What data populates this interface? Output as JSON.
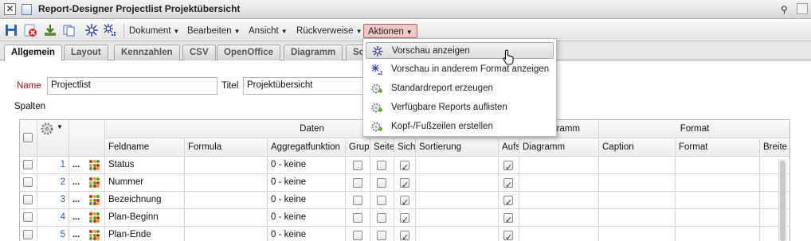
{
  "window": {
    "title": "Report-Designer Projectlist Projektübersicht",
    "close_glyph": "✕",
    "pin_glyph": "⚲"
  },
  "toolbar": {
    "icons": [
      "save-icon",
      "delete-icon",
      "download-icon",
      "copy-icon",
      "preview-icon",
      "preview-format-icon"
    ],
    "menus": [
      "Dokument",
      "Bearbeiten",
      "Ansicht",
      "Rückverweise",
      "Aktionen"
    ],
    "active_menu": "Aktionen",
    "active_color": "#f2c7c7"
  },
  "tabs": {
    "items": [
      "Allgemein",
      "Layout",
      "Kennzahlen",
      "CSV",
      "OpenOffice",
      "Diagramm",
      "So"
    ],
    "active": "Allgemein"
  },
  "form": {
    "name_label": "Name",
    "name_value": "Projectlist",
    "titel_label": "Titel",
    "titel_value": "Projektübersicht",
    "spalten_label": "Spalten"
  },
  "table": {
    "group_headers": {
      "daten": "Daten",
      "diagramm": "Diagramm",
      "format": "Format"
    },
    "columns": [
      "Feldname",
      "Formula",
      "Aggregatfunktion",
      "Grup",
      "Seite",
      "Sicht",
      "Sortierung",
      "Aufs",
      "Diagramm",
      "Caption",
      "Format",
      "Breite"
    ],
    "rows": [
      {
        "num": "1",
        "dots": "...",
        "feldname": "Status",
        "formula": "",
        "aggregat": "0 - keine",
        "grup": false,
        "seite": false,
        "sicht": true,
        "sortierung": "",
        "aufs": true
      },
      {
        "num": "2",
        "dots": "...",
        "feldname": "Nummer",
        "formula": "",
        "aggregat": "0 - keine",
        "grup": false,
        "seite": false,
        "sicht": true,
        "sortierung": "",
        "aufs": true
      },
      {
        "num": "3",
        "dots": "...",
        "feldname": "Bezeichnung",
        "formula": "",
        "aggregat": "0 - keine",
        "grup": false,
        "seite": false,
        "sicht": true,
        "sortierung": "",
        "aufs": true
      },
      {
        "num": "4",
        "dots": "...",
        "feldname": "Plan-Beginn",
        "formula": "",
        "aggregat": "0 - keine",
        "grup": false,
        "seite": false,
        "sicht": true,
        "sortierung": "",
        "aufs": true
      },
      {
        "num": "5",
        "dots": "...",
        "feldname": "Plan-Ende",
        "formula": "",
        "aggregat": "0 - keine",
        "grup": false,
        "seite": false,
        "sicht": true,
        "sortierung": "",
        "aufs": true
      }
    ]
  },
  "dropdown": {
    "items": [
      {
        "label": "Vorschau anzeigen",
        "icon": "preview-icon",
        "highlighted": true
      },
      {
        "label": "Vorschau in anderem Format anzeigen",
        "icon": "preview-format-icon",
        "highlighted": false
      },
      {
        "label": "Standardreport erzeugen",
        "icon": "gear-icon",
        "highlighted": false
      },
      {
        "label": "Verfügbare Reports auflisten",
        "icon": "gear-icon",
        "highlighted": false
      },
      {
        "label": "Kopf-/Fußzeilen erstellen",
        "icon": "gear-icon",
        "highlighted": false
      }
    ]
  }
}
